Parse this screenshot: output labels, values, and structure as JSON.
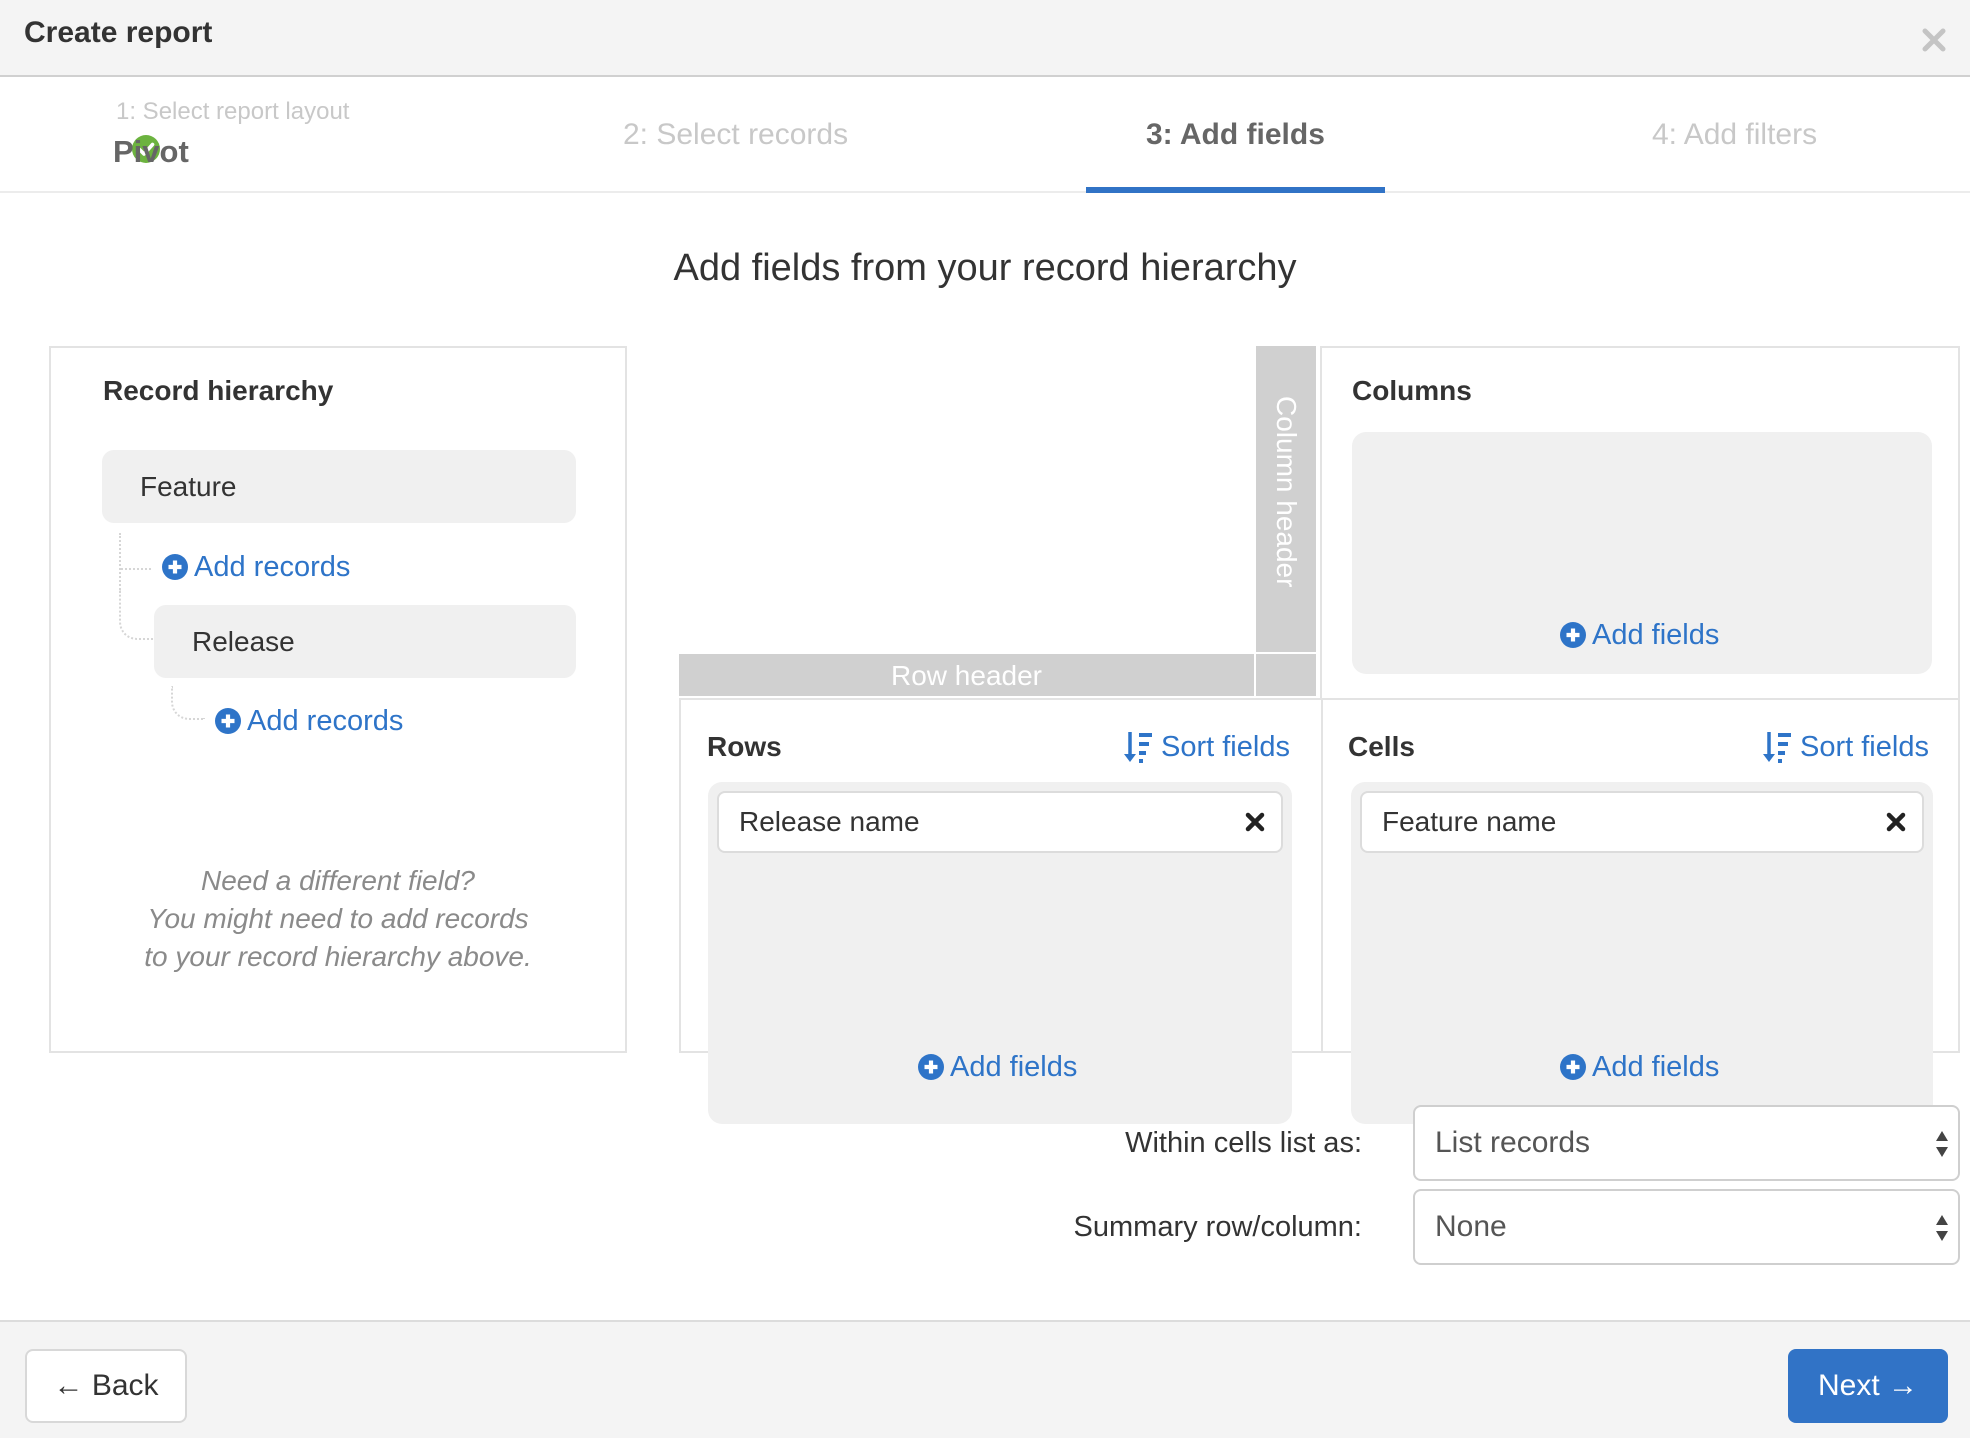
{
  "window": {
    "title": "Create report",
    "close_icon": "close-icon"
  },
  "steps": [
    {
      "label": "1: Select report layout",
      "value": "Pivot",
      "state": "complete"
    },
    {
      "label": "2: Select records",
      "state": "inactive"
    },
    {
      "label": "3: Add fields",
      "state": "active"
    },
    {
      "label": "4: Add filters",
      "state": "inactive"
    }
  ],
  "main": {
    "title": "Add fields from your record hierarchy"
  },
  "hierarchy": {
    "heading": "Record hierarchy",
    "records": [
      {
        "name": "Feature",
        "add_label": "Add records"
      },
      {
        "name": "Release",
        "add_label": "Add records"
      }
    ],
    "hint_lines": [
      "Need a different field?",
      "You might need to add records",
      "to your record hierarchy above."
    ]
  },
  "pivot": {
    "column_header_label": "Column header",
    "row_header_label": "Row header",
    "columns": {
      "heading": "Columns",
      "fields": [],
      "add_label": "Add fields"
    },
    "rows": {
      "heading": "Rows",
      "sort_label": "Sort fields",
      "fields": [
        "Release name"
      ],
      "add_label": "Add fields"
    },
    "cells": {
      "heading": "Cells",
      "sort_label": "Sort fields",
      "fields": [
        "Feature name"
      ],
      "add_label": "Add fields"
    }
  },
  "options": {
    "within_cells": {
      "label": "Within cells list as:",
      "value": "List records"
    },
    "summary": {
      "label": "Summary row/column:",
      "value": "None"
    }
  },
  "footer": {
    "back_label": "← Back",
    "next_label": "Next →"
  },
  "colors": {
    "accent": "#3173c6",
    "link": "#2e74c8",
    "success": "#6cb33f",
    "header_strip": "#d0d0d0"
  }
}
